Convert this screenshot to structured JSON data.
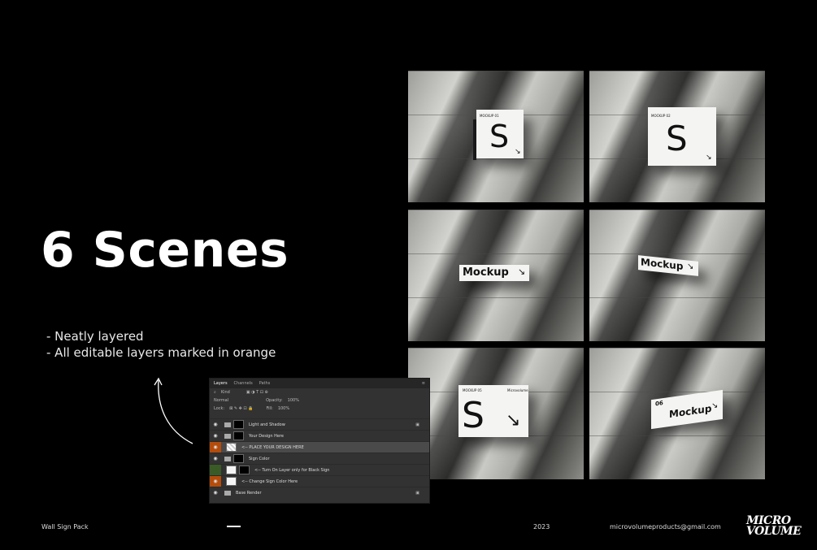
{
  "headline": "6 Scenes",
  "bullets": [
    "- Neatly layered",
    "- All editable layers marked in orange"
  ],
  "scenes": [
    {
      "type": "cube",
      "label": "MOCKUP 01",
      "letter": "S"
    },
    {
      "type": "cube",
      "label": "MOCKUP 02",
      "letter": "S"
    },
    {
      "type": "bar",
      "text": "Mockup"
    },
    {
      "type": "bar-angled",
      "text": "Mockup"
    },
    {
      "type": "panel",
      "label_left": "MOCKUP 05",
      "label_right": "Microvolume",
      "letter": "S"
    },
    {
      "type": "bar-number",
      "number": "06",
      "text": "Mockup"
    }
  ],
  "layers_panel": {
    "tabs": [
      "Layers",
      "Channels",
      "Paths"
    ],
    "filter_label": "Kind",
    "blend_mode": "Normal",
    "opacity_label": "Opacity:",
    "opacity_value": "100%",
    "lock_label": "Lock:",
    "fill_label": "Fill:",
    "fill_value": "100%",
    "layers": [
      {
        "name": "Light and Shadow",
        "eye": "normal",
        "locked": true
      },
      {
        "name": "Your Design Here",
        "eye": "normal",
        "locked": false
      },
      {
        "name": "<-- PLACE YOUR DESIGN HERE",
        "eye": "orange",
        "locked": false
      },
      {
        "name": "Sign Color",
        "eye": "normal",
        "locked": false
      },
      {
        "name": "<-- Turn On Layer only for Black Sign",
        "eye": "green",
        "locked": false
      },
      {
        "name": "<-- Change Sign Color Here",
        "eye": "orange",
        "locked": false
      },
      {
        "name": "Base Render",
        "eye": "normal",
        "locked": true
      }
    ]
  },
  "footer": {
    "title": "Wall Sign Pack",
    "year": "2023",
    "email": "microvolumeproducts@gmail.com",
    "logo_line1": "MICRO",
    "logo_line2": "VOLUME"
  },
  "colors": {
    "background": "#000000",
    "editable_orange": "#b44c0c",
    "green_marker": "#3a5a26"
  }
}
